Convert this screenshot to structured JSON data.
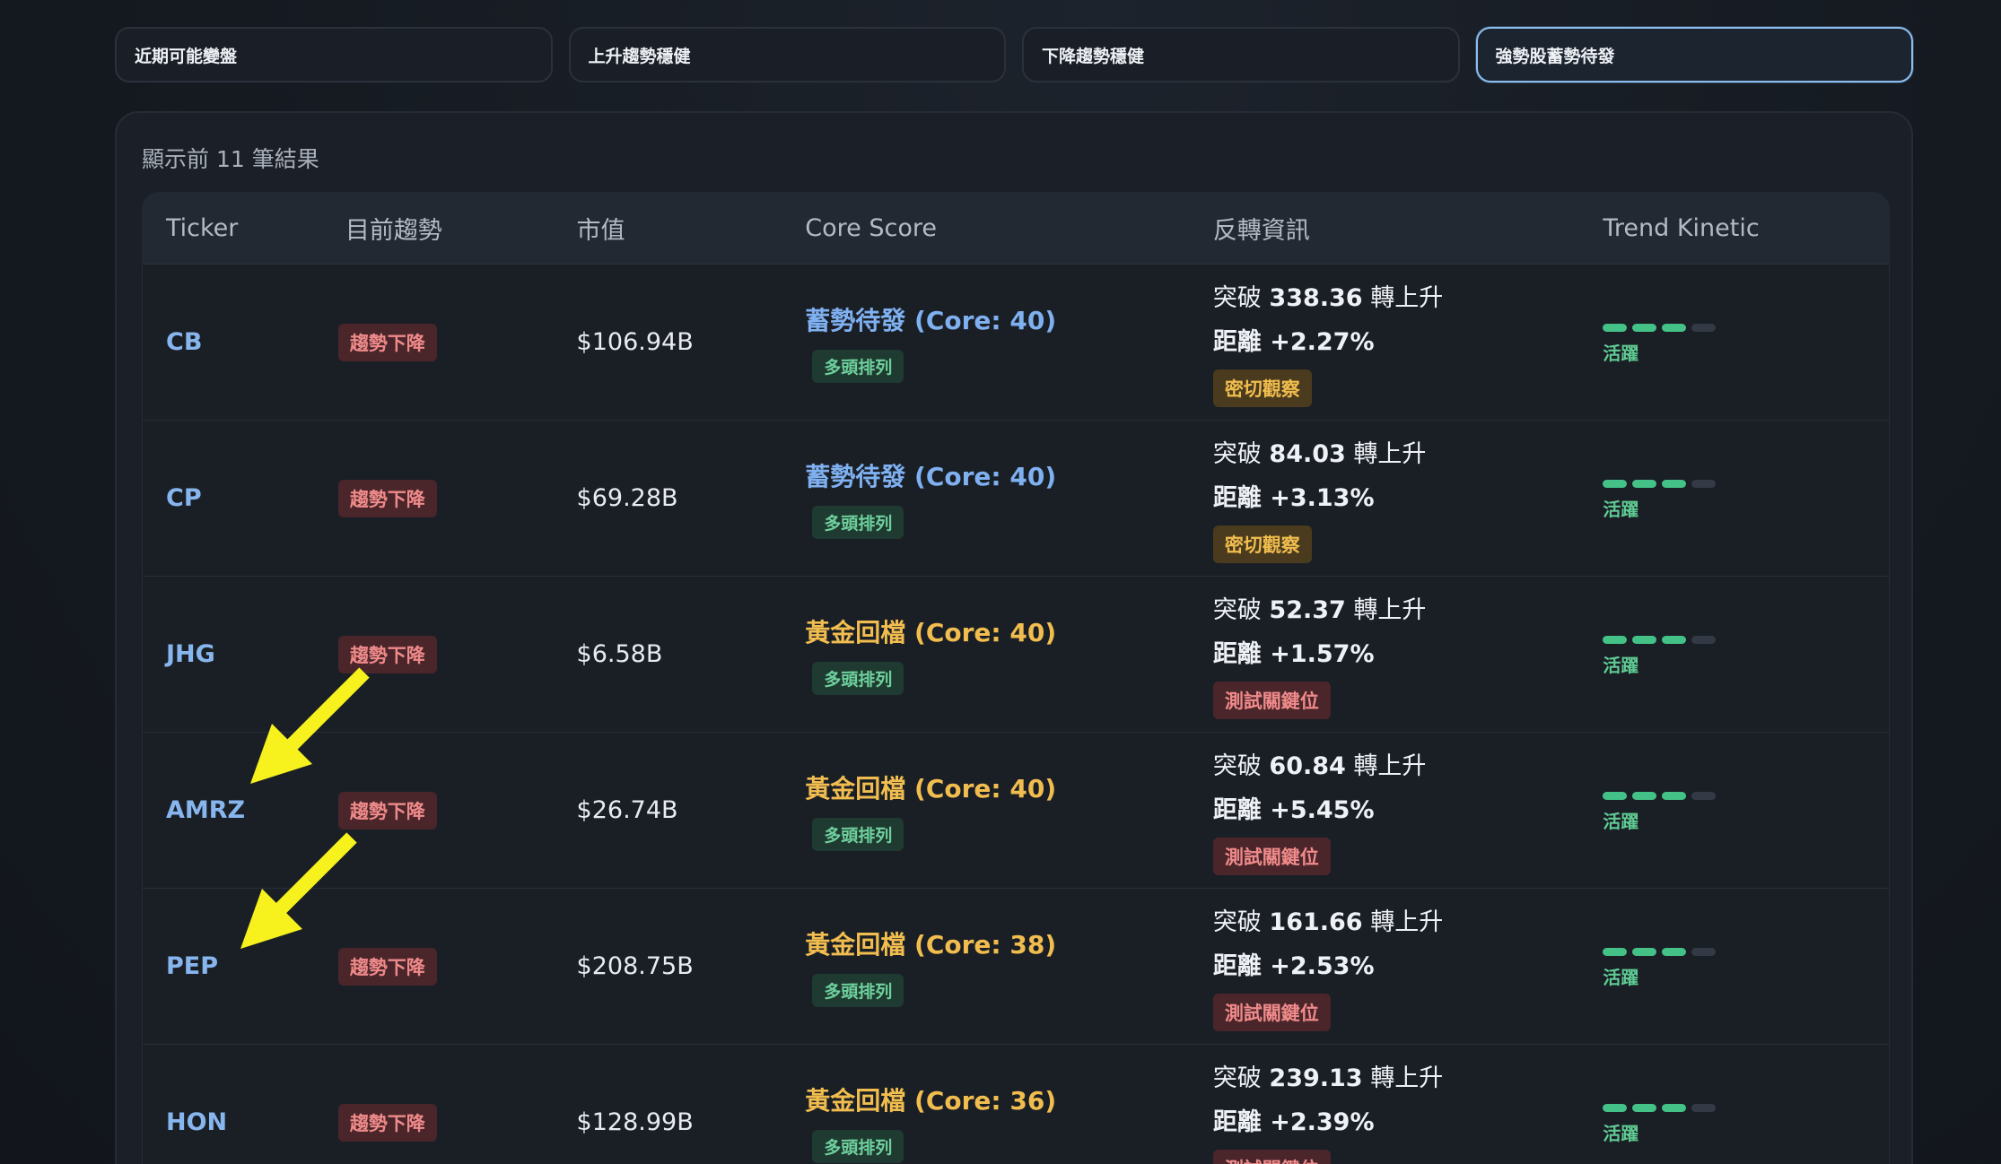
{
  "filters": [
    {
      "label": "近期可能變盤",
      "active": false
    },
    {
      "label": "上升趨勢穩健",
      "active": false
    },
    {
      "label": "下降趨勢穩健",
      "active": false
    },
    {
      "label": "強勢股蓄勢待發",
      "active": true
    }
  ],
  "result_count": "顯示前 11 筆結果",
  "columns": [
    "Ticker",
    "目前趨勢",
    "市值",
    "Core Score",
    "反轉資訊",
    "Trend Kinetic"
  ],
  "rows": [
    {
      "ticker": "CB",
      "trend": "趨勢下降",
      "mcap": "$106.94B",
      "core": "蓄勢待發 (Core: 40)",
      "core_color": "blue",
      "align": "多頭排列",
      "break_prefix": "突破 ",
      "break_value": "338.36",
      "break_suffix": " 轉上升",
      "distance": "距離 +2.27%",
      "watch": "密切觀察",
      "watch_color": "amber",
      "kinetic_level": 3,
      "kinetic_max": 4,
      "kinetic_label": "活躍"
    },
    {
      "ticker": "CP",
      "trend": "趨勢下降",
      "mcap": "$69.28B",
      "core": "蓄勢待發 (Core: 40)",
      "core_color": "blue",
      "align": "多頭排列",
      "break_prefix": "突破 ",
      "break_value": "84.03",
      "break_suffix": " 轉上升",
      "distance": "距離 +3.13%",
      "watch": "密切觀察",
      "watch_color": "amber",
      "kinetic_level": 3,
      "kinetic_max": 4,
      "kinetic_label": "活躍"
    },
    {
      "ticker": "JHG",
      "trend": "趨勢下降",
      "mcap": "$6.58B",
      "core": "黃金回檔 (Core: 40)",
      "core_color": "gold",
      "align": "多頭排列",
      "break_prefix": "突破 ",
      "break_value": "52.37",
      "break_suffix": " 轉上升",
      "distance": "距離 +1.57%",
      "watch": "測試關鍵位",
      "watch_color": "red",
      "kinetic_level": 3,
      "kinetic_max": 4,
      "kinetic_label": "活躍"
    },
    {
      "ticker": "AMRZ",
      "trend": "趨勢下降",
      "mcap": "$26.74B",
      "core": "黃金回檔 (Core: 40)",
      "core_color": "gold",
      "align": "多頭排列",
      "break_prefix": "突破 ",
      "break_value": "60.84",
      "break_suffix": " 轉上升",
      "distance": "距離 +5.45%",
      "watch": "測試關鍵位",
      "watch_color": "red",
      "kinetic_level": 3,
      "kinetic_max": 4,
      "kinetic_label": "活躍"
    },
    {
      "ticker": "PEP",
      "trend": "趨勢下降",
      "mcap": "$208.75B",
      "core": "黃金回檔 (Core: 38)",
      "core_color": "gold",
      "align": "多頭排列",
      "break_prefix": "突破 ",
      "break_value": "161.66",
      "break_suffix": " 轉上升",
      "distance": "距離 +2.53%",
      "watch": "測試關鍵位",
      "watch_color": "red",
      "kinetic_level": 3,
      "kinetic_max": 4,
      "kinetic_label": "活躍"
    },
    {
      "ticker": "HON",
      "trend": "趨勢下降",
      "mcap": "$128.99B",
      "core": "黃金回檔 (Core: 36)",
      "core_color": "gold",
      "align": "多頭排列",
      "break_prefix": "突破 ",
      "break_value": "239.13",
      "break_suffix": " 轉上升",
      "distance": "距離 +2.39%",
      "watch": "測試關鍵位",
      "watch_color": "red",
      "kinetic_level": 3,
      "kinetic_max": 4,
      "kinetic_label": "活躍"
    }
  ],
  "colors": {
    "accent_blue": "#7fb0f0",
    "accent_gold": "#f1bd4e",
    "trend_down_red": "#f08a8a",
    "kinetic_green": "#44c187",
    "annotation_arrow": "#f7f21e"
  },
  "annotations": {
    "arrow_icon": "arrow-down-left-icon",
    "arrow_color": "#f7f21e"
  }
}
